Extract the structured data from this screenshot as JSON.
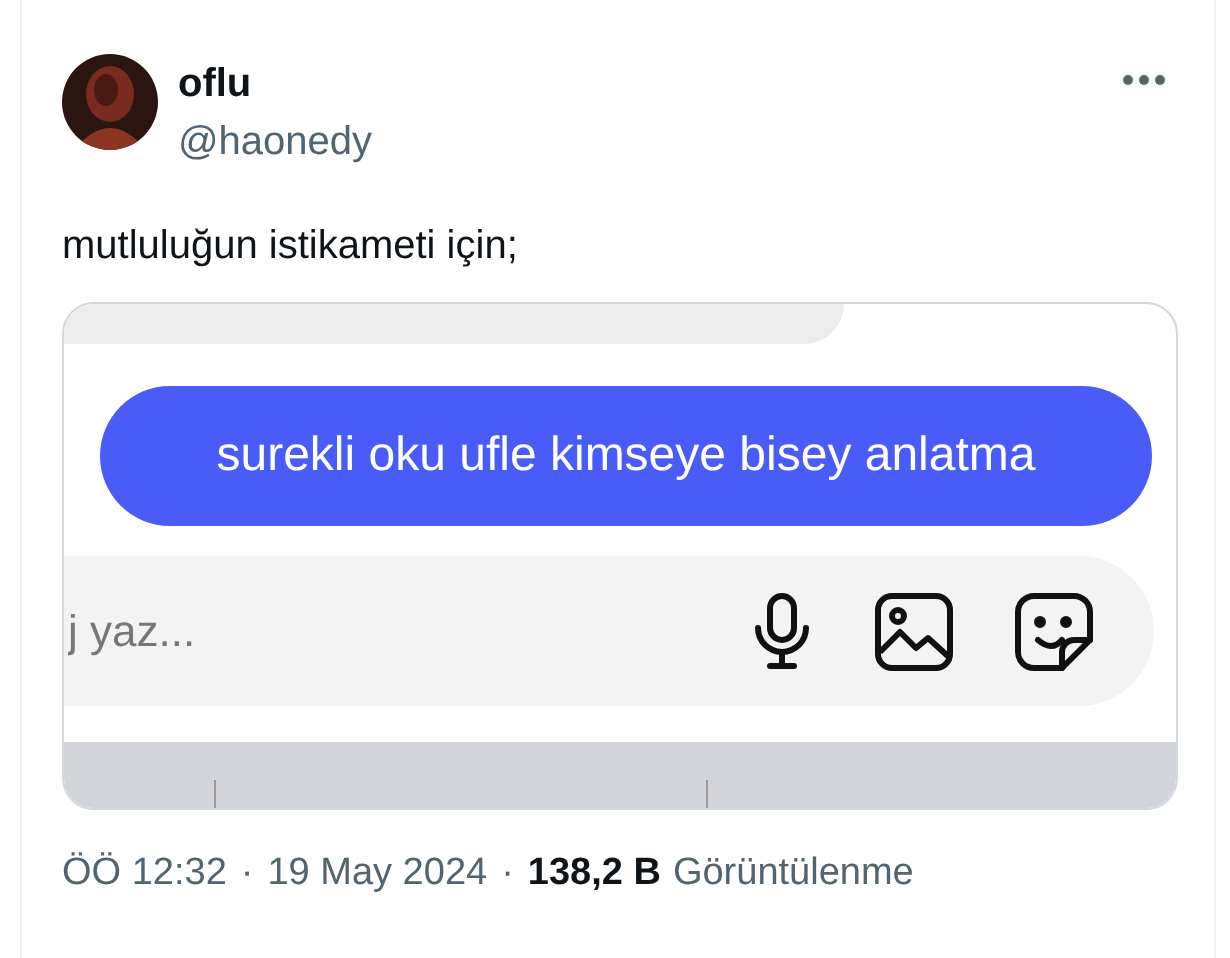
{
  "post": {
    "author": {
      "name": "oflu",
      "handle": "@haonedy"
    },
    "text": "mutluluğun istikameti için;",
    "media": {
      "message": {
        "text": "surekli oku ufle kimseye bisey anlatma"
      },
      "composer": {
        "placeholder": "j yaz..."
      }
    },
    "meta": {
      "time": "ÖÖ 12:32",
      "separator": "·",
      "date": "19 May 2024",
      "separator_2": "·",
      "views": "138,2 B",
      "views_label": "Görüntülenme"
    }
  }
}
